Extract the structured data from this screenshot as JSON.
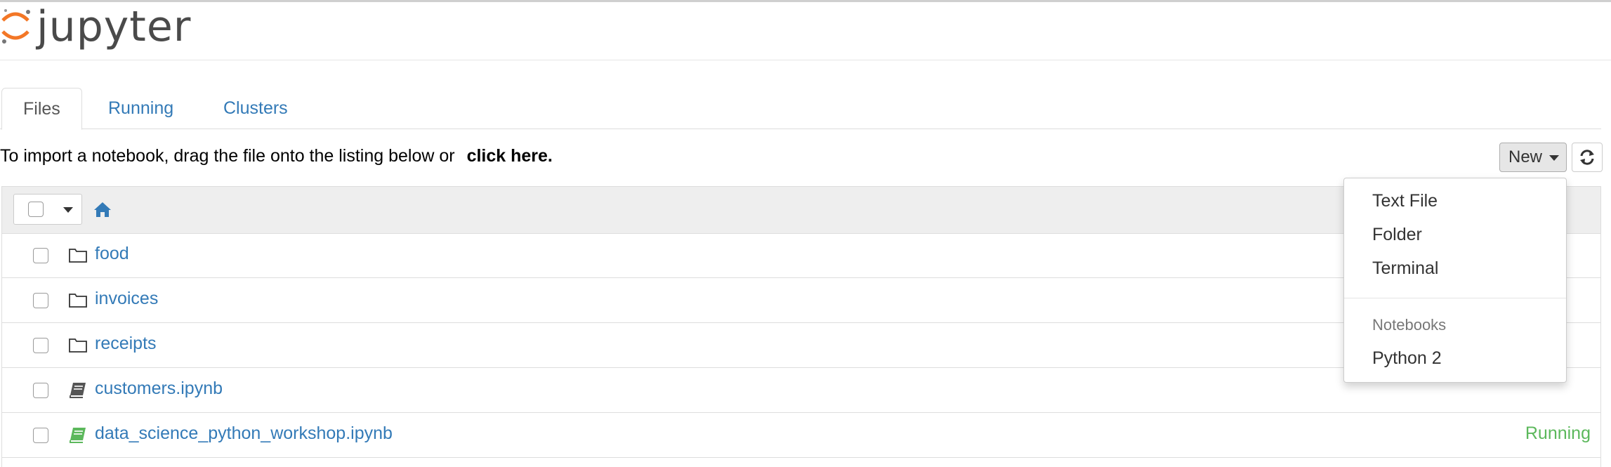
{
  "app": {
    "brand": "jupyter",
    "brand_colors": {
      "orange": "#f37726",
      "grey": "#4a4a4a"
    }
  },
  "tabs": [
    {
      "label": "Files",
      "active": true
    },
    {
      "label": "Running",
      "active": false
    },
    {
      "label": "Clusters",
      "active": false
    }
  ],
  "toolbar": {
    "import_text": "To import a notebook, drag the file onto the listing below or",
    "import_link": "click here.",
    "new_label": "New",
    "refresh_icon": "refresh-icon"
  },
  "listing": {
    "home_icon": "home-icon",
    "items": [
      {
        "name": "food",
        "type": "folder",
        "icon": "folder-icon",
        "status": ""
      },
      {
        "name": "invoices",
        "type": "folder",
        "icon": "folder-icon",
        "status": ""
      },
      {
        "name": "receipts",
        "type": "folder",
        "icon": "folder-icon",
        "status": ""
      },
      {
        "name": "customers.ipynb",
        "type": "notebook",
        "icon": "notebook-icon",
        "status": ""
      },
      {
        "name": "data_science_python_workshop.ipynb",
        "type": "notebook-running",
        "icon": "notebook-icon",
        "status": "Running"
      }
    ]
  },
  "new_menu": {
    "items": [
      "Text File",
      "Folder",
      "Terminal"
    ],
    "section_header": "Notebooks",
    "kernels": [
      "Python 2"
    ]
  },
  "colors": {
    "link": "#337ab7",
    "running": "#5cb85c",
    "notebook_grey": "#555555",
    "notebook_green": "#5cb85c"
  }
}
